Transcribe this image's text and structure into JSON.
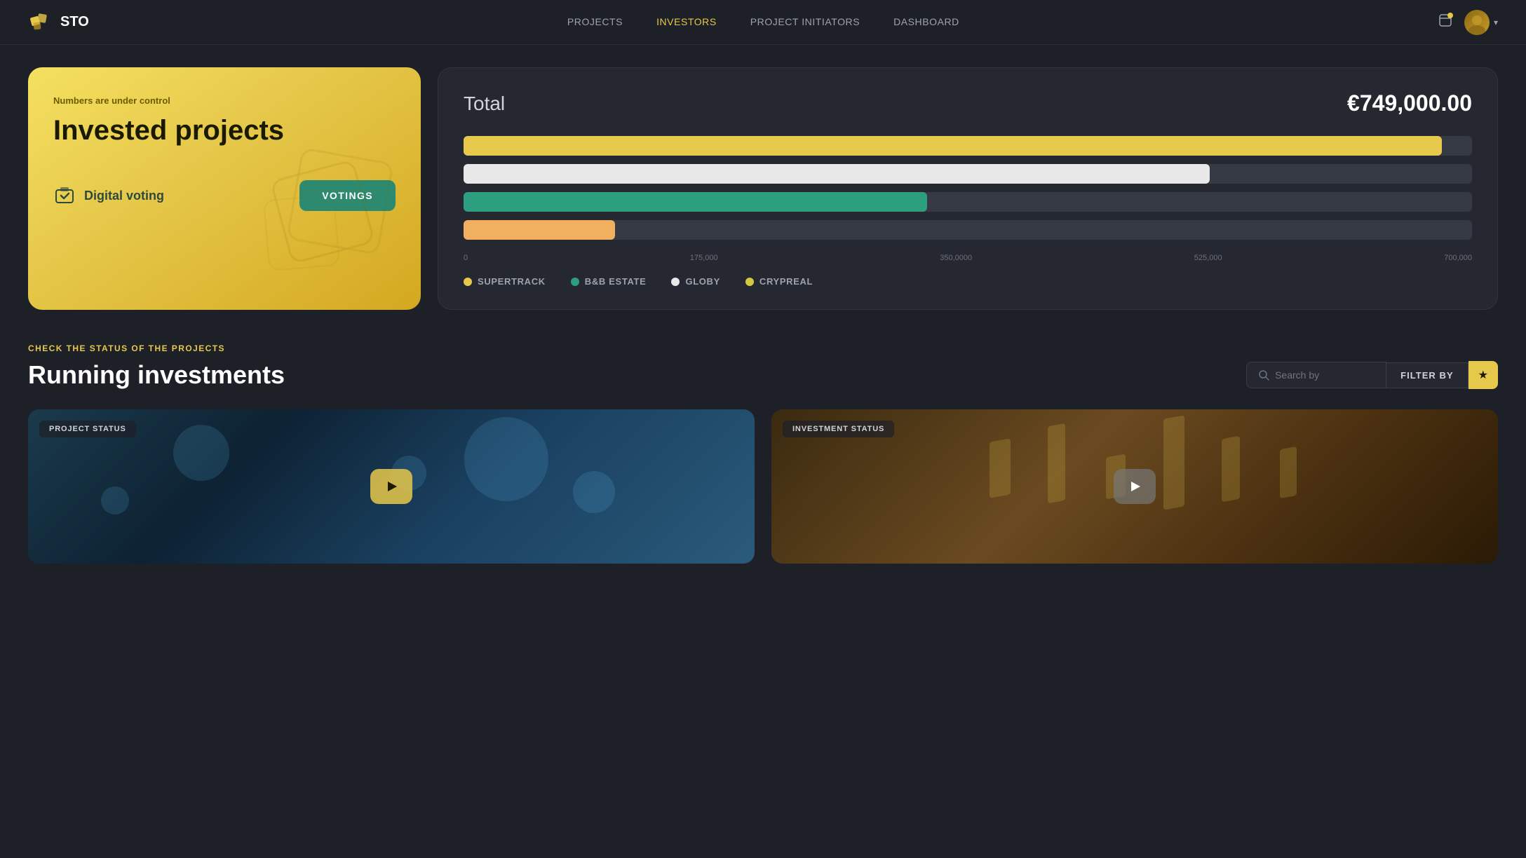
{
  "brand": {
    "name": "STO"
  },
  "nav": {
    "links": [
      {
        "label": "PROJECTS",
        "active": false
      },
      {
        "label": "INVESTORS",
        "active": true
      },
      {
        "label": "PROJECT INITIATORS",
        "active": false
      },
      {
        "label": "DASHBOARD",
        "active": false
      }
    ]
  },
  "hero": {
    "subtitle": "Numbers are under control",
    "title": "Invested projects",
    "voting_label": "Digital voting",
    "voting_btn": "VOTINGS"
  },
  "chart": {
    "title": "Total",
    "total": "€749,000.00",
    "bars": [
      {
        "label": "Crypreal",
        "color": "yellow",
        "width_pct": 97
      },
      {
        "label": "Globy",
        "color": "white",
        "width_pct": 74
      },
      {
        "label": "B&B estate",
        "color": "teal",
        "width_pct": 46
      },
      {
        "label": "SUPERTRACK",
        "color": "orange",
        "width_pct": 15
      }
    ],
    "axis": [
      "0",
      "175,000",
      "350,0000",
      "525,000",
      "700,000"
    ],
    "legend": [
      {
        "label": "SUPERTRACK",
        "dot": "yellow"
      },
      {
        "label": "B&B estate",
        "dot": "teal"
      },
      {
        "label": "Globy",
        "dot": "white"
      },
      {
        "label": "Crypreal",
        "dot": "yellow2"
      }
    ]
  },
  "investments": {
    "section_label": "CHECK THE STATUS OF THE PROJECTS",
    "section_title": "Running investments",
    "search_placeholder": "Search by",
    "filter_btn": "FILTER BY",
    "cards": [
      {
        "badge": "PROJECT STATUS",
        "play": "yellow"
      },
      {
        "badge": "INVESTMENT STATUS",
        "play": "gray"
      }
    ]
  }
}
